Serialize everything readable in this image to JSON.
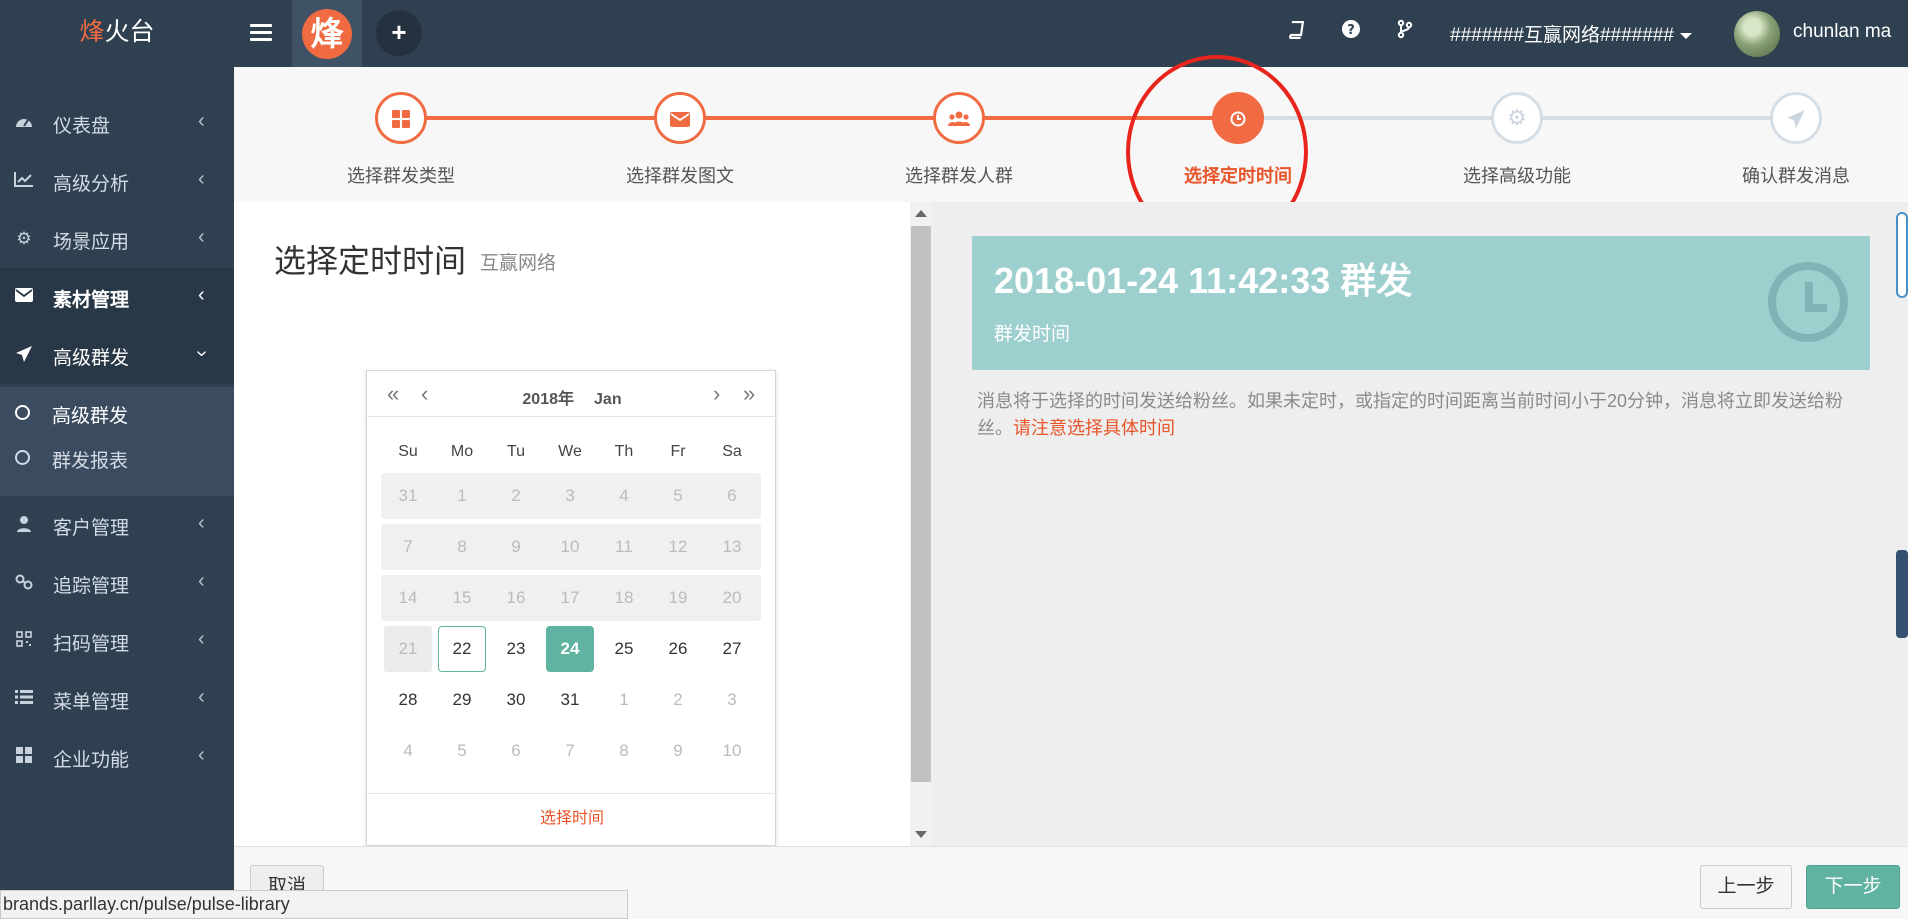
{
  "topbar": {
    "brand_highlight": "烽",
    "brand_rest": "火台",
    "logo_char": "烽",
    "org_name": "#######互赢网络#######",
    "username": "chunlan ma"
  },
  "sidebar": {
    "items": [
      {
        "label": "仪表盘",
        "icon": "dashboard-icon"
      },
      {
        "label": "高级分析",
        "icon": "line-chart-icon"
      },
      {
        "label": "场景应用",
        "icon": "gear-icon"
      },
      {
        "label": "素材管理",
        "icon": "envelope-icon"
      },
      {
        "label": "高级群发",
        "icon": "paper-plane-icon"
      },
      {
        "label": "客户管理",
        "icon": "user-icon"
      },
      {
        "label": "追踪管理",
        "icon": "link-icon"
      },
      {
        "label": "扫码管理",
        "icon": "qrcode-icon"
      },
      {
        "label": "菜单管理",
        "icon": "list-icon"
      },
      {
        "label": "企业功能",
        "icon": "grid-icon"
      }
    ],
    "sub_items": [
      {
        "label": "高级群发"
      },
      {
        "label": "群发报表"
      }
    ]
  },
  "steps": [
    {
      "label": "选择群发类型",
      "icon": "grid-icon",
      "state": "done"
    },
    {
      "label": "选择群发图文",
      "icon": "envelope-icon",
      "state": "done"
    },
    {
      "label": "选择群发人群",
      "icon": "users-icon",
      "state": "done"
    },
    {
      "label": "选择定时时间",
      "icon": "clock-icon",
      "state": "current"
    },
    {
      "label": "选择高级功能",
      "icon": "gear-icon",
      "state": "todo"
    },
    {
      "label": "确认群发消息",
      "icon": "paper-plane-icon",
      "state": "todo"
    }
  ],
  "panel": {
    "title": "选择定时时间",
    "subtitle": "互赢网络"
  },
  "calendar": {
    "year": "2018年",
    "month": "Jan",
    "nav_prev_year": "«",
    "nav_prev_month": "‹",
    "nav_next_month": "›",
    "nav_next_year": "»",
    "weekdays": [
      "Su",
      "Mo",
      "Tu",
      "We",
      "Th",
      "Fr",
      "Sa"
    ],
    "weeks": [
      [
        "31",
        "1",
        "2",
        "3",
        "4",
        "5",
        "6"
      ],
      [
        "7",
        "8",
        "9",
        "10",
        "11",
        "12",
        "13"
      ],
      [
        "14",
        "15",
        "16",
        "17",
        "18",
        "19",
        "20"
      ],
      [
        "21",
        "22",
        "23",
        "24",
        "25",
        "26",
        "27"
      ],
      [
        "28",
        "29",
        "30",
        "31",
        "1",
        "2",
        "3"
      ],
      [
        "4",
        "5",
        "6",
        "7",
        "8",
        "9",
        "10"
      ]
    ],
    "today": "22",
    "selected": "24",
    "footer": "选择时间"
  },
  "info": {
    "time": "2018-01-24 11:42:33 群发",
    "sub": "群发时间",
    "notice": "消息将于选择的时间发送给粉丝。如果未定时，或指定的时间距离当前时间小于20分钟，消息将立即发送给粉丝。",
    "warning": "请注意选择具体时间"
  },
  "buttons": {
    "cancel": "取消",
    "prev": "上一步",
    "next": "下一步"
  },
  "status_url": "brands.parllay.cn/pulse/pulse-library",
  "colors": {
    "accent": "#f06b42",
    "primary": "#5fb3a0",
    "sidebar": "#2f4050",
    "info_box": "#9dcfcf",
    "highlight_ring": "#e8251c"
  }
}
